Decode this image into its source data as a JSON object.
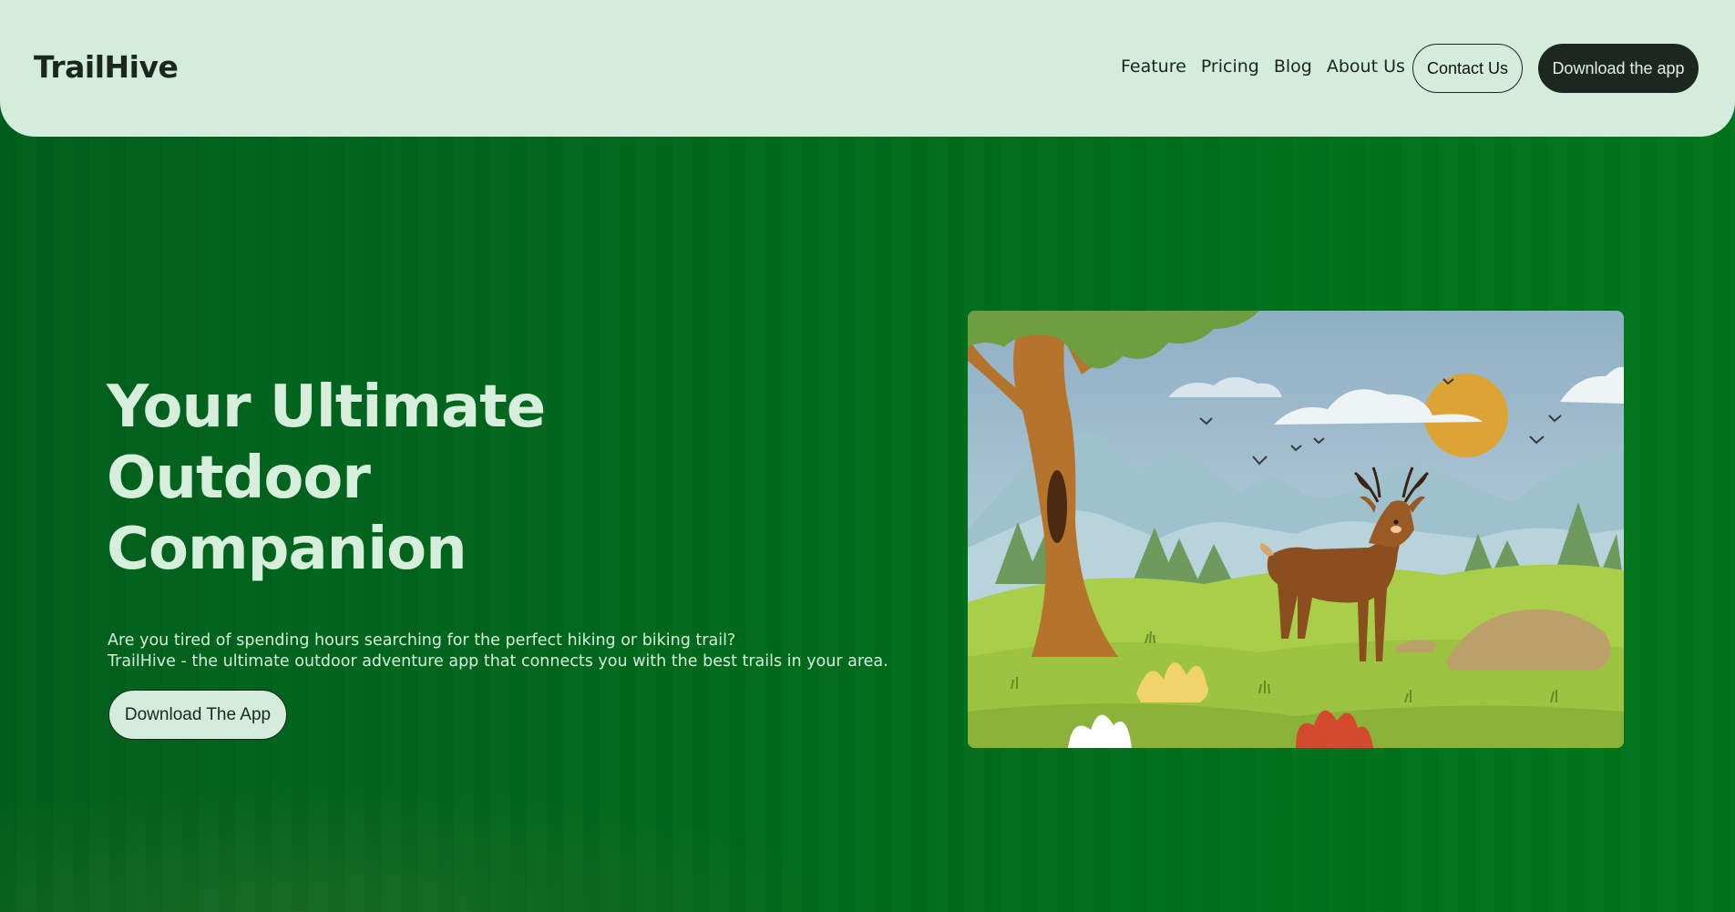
{
  "header": {
    "logo": "TrailHive",
    "nav": [
      "Feature",
      "Pricing",
      "Blog",
      "About Us"
    ],
    "contact_label": "Contact Us",
    "download_label": "Download the app"
  },
  "hero": {
    "title_lines": [
      "Your Ultimate",
      "Outdoor",
      "Companion"
    ],
    "desc_line1": "Are you tired of spending hours searching for the perfect hiking or biking trail?",
    "desc_line2": "TrailHive - the ultimate outdoor adventure app that connects you with the best trails in your area.",
    "cta_label": "Download The App"
  },
  "colors": {
    "background": "#00721a",
    "header_bg": "#d4ecdc",
    "dark": "#1c2721",
    "light_text": "#d6eedb"
  }
}
